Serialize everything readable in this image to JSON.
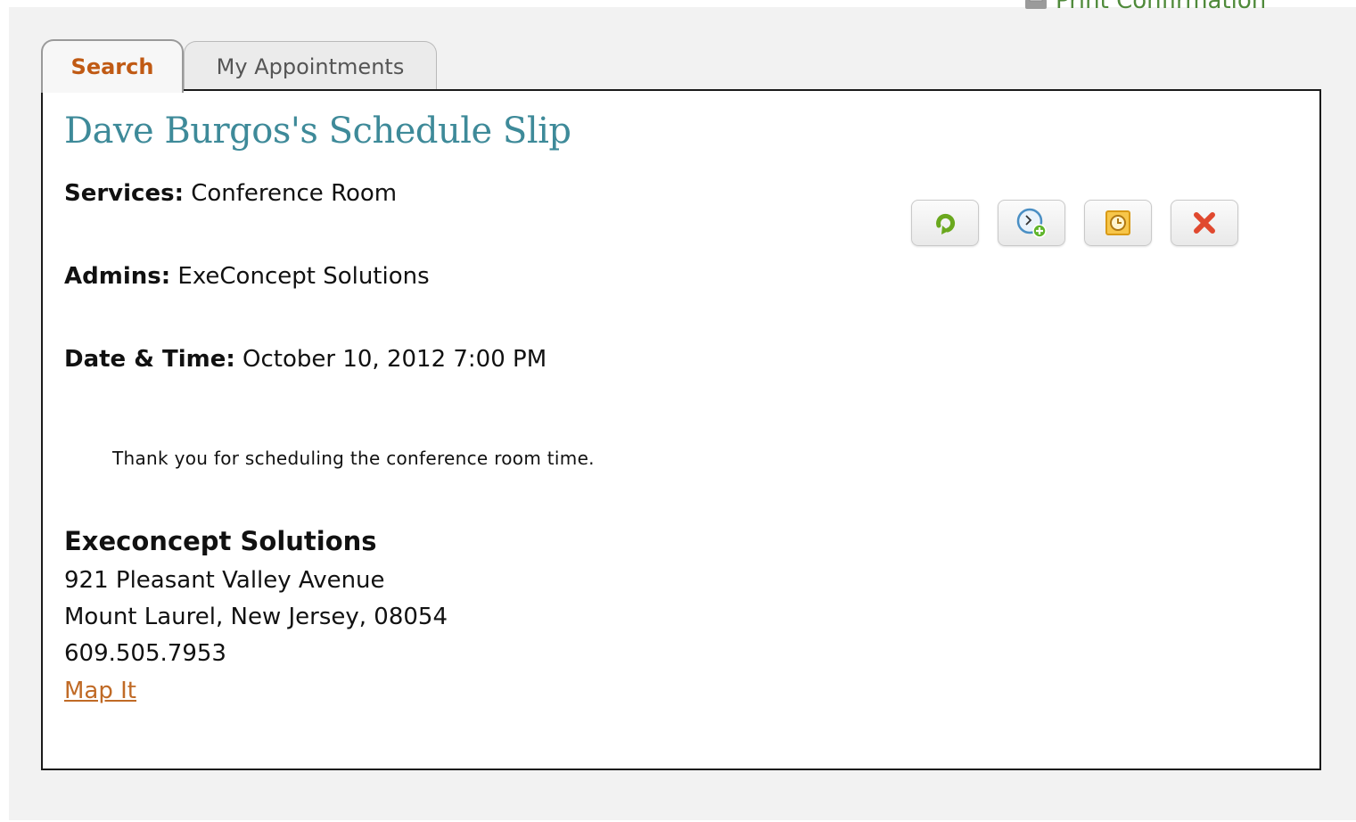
{
  "header": {
    "print_label": "Print Confirmation"
  },
  "tabs": [
    {
      "label": "Search",
      "active": true
    },
    {
      "label": "My Appointments",
      "active": false
    }
  ],
  "slip": {
    "title": "Dave Burgos's Schedule Slip",
    "services_label": "Services:",
    "services_value": "Conference Room",
    "admins_label": "Admins:",
    "admins_value": "ExeConcept Solutions",
    "datetime_label": "Date & Time:",
    "datetime_value": "October 10, 2012 7:00 PM",
    "message": "Thank you for scheduling the conference room time."
  },
  "actions": [
    {
      "icon": "reschedule-icon",
      "color": "#6aa81e"
    },
    {
      "icon": "add-to-calendar-icon",
      "color": "#4a8fc4"
    },
    {
      "icon": "reminder-clock-icon",
      "color": "#e0a31f"
    },
    {
      "icon": "cancel-icon",
      "color": "#e0492f"
    }
  ],
  "company": {
    "name": "Execoncept Solutions",
    "address_line1": "921 Pleasant Valley Avenue",
    "address_line2": "Mount Laurel, New Jersey, 08054",
    "phone": "609.505.7953",
    "map_link": "Map It"
  },
  "colors": {
    "title": "#3e8a99",
    "active_tab": "#c05a14",
    "link": "#c06a26",
    "print_link": "#4f8a3a"
  }
}
